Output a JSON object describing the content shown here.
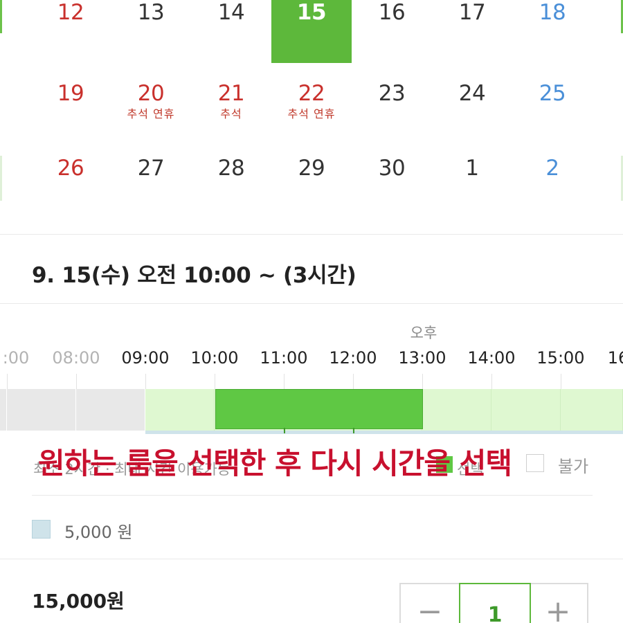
{
  "calendar": {
    "accent_color": "#5db83b",
    "weeks": [
      {
        "days": [
          {
            "num": "12",
            "sub": "",
            "kind": "sun"
          },
          {
            "num": "13",
            "sub": "",
            "kind": "wk"
          },
          {
            "num": "14",
            "sub": "",
            "kind": "wk"
          },
          {
            "num": "15",
            "sub": "",
            "kind": "wk",
            "selected": true
          },
          {
            "num": "16",
            "sub": "",
            "kind": "wk"
          },
          {
            "num": "17",
            "sub": "",
            "kind": "wk"
          },
          {
            "num": "18",
            "sub": "",
            "kind": "sat"
          }
        ]
      },
      {
        "days": [
          {
            "num": "19",
            "sub": "",
            "kind": "sun"
          },
          {
            "num": "20",
            "sub": "추석 연휴",
            "kind": "hol"
          },
          {
            "num": "21",
            "sub": "추석",
            "kind": "hol"
          },
          {
            "num": "22",
            "sub": "추석 연휴",
            "kind": "hol"
          },
          {
            "num": "23",
            "sub": "",
            "kind": "wk"
          },
          {
            "num": "24",
            "sub": "",
            "kind": "wk"
          },
          {
            "num": "25",
            "sub": "",
            "kind": "sat"
          }
        ]
      },
      {
        "days": [
          {
            "num": "26",
            "sub": "",
            "kind": "sun"
          },
          {
            "num": "27",
            "sub": "",
            "kind": "wk"
          },
          {
            "num": "28",
            "sub": "",
            "kind": "wk"
          },
          {
            "num": "29",
            "sub": "",
            "kind": "wk"
          },
          {
            "num": "30",
            "sub": "",
            "kind": "wk"
          },
          {
            "num": "1",
            "sub": "",
            "kind": "wk"
          },
          {
            "num": "2",
            "sub": "",
            "kind": "sat"
          }
        ]
      }
    ]
  },
  "selection": {
    "summary": "9. 15(수) 오전 10:00 ~ (3시간)"
  },
  "timeline": {
    "ampm_label": "오후",
    "hours": [
      {
        "label": ":00",
        "past": true
      },
      {
        "label": "08:00",
        "past": true
      },
      {
        "label": "09:00",
        "past": false
      },
      {
        "label": "10:00",
        "past": false
      },
      {
        "label": "11:00",
        "past": false
      },
      {
        "label": "12:00",
        "past": false
      },
      {
        "label": "13:00",
        "past": false
      },
      {
        "label": "14:00",
        "past": false
      },
      {
        "label": "15:00",
        "past": false
      },
      {
        "label": "16",
        "past": false
      }
    ],
    "first_available_hour": 9,
    "selected_start_hour": 10,
    "selected_end_hour": 13,
    "available_color": "#dff8d1",
    "unavailable_color": "#e8e8e8",
    "selected_color": "#5fc844"
  },
  "legend": {
    "minimum_text": "최소 2시간 · 최대 시간 이용가능",
    "selected_label": "선택",
    "unavailable_label": "불가",
    "overlay_notice": "원하는 룸을 선택한 후 다시 시간을 선택"
  },
  "pricing": {
    "unit_price_label": "5,000 원",
    "swatch_color": "#cfe3ea"
  },
  "footer": {
    "total": "15,000원",
    "quantity": "1",
    "minus_label": "−",
    "plus_label": "+"
  }
}
